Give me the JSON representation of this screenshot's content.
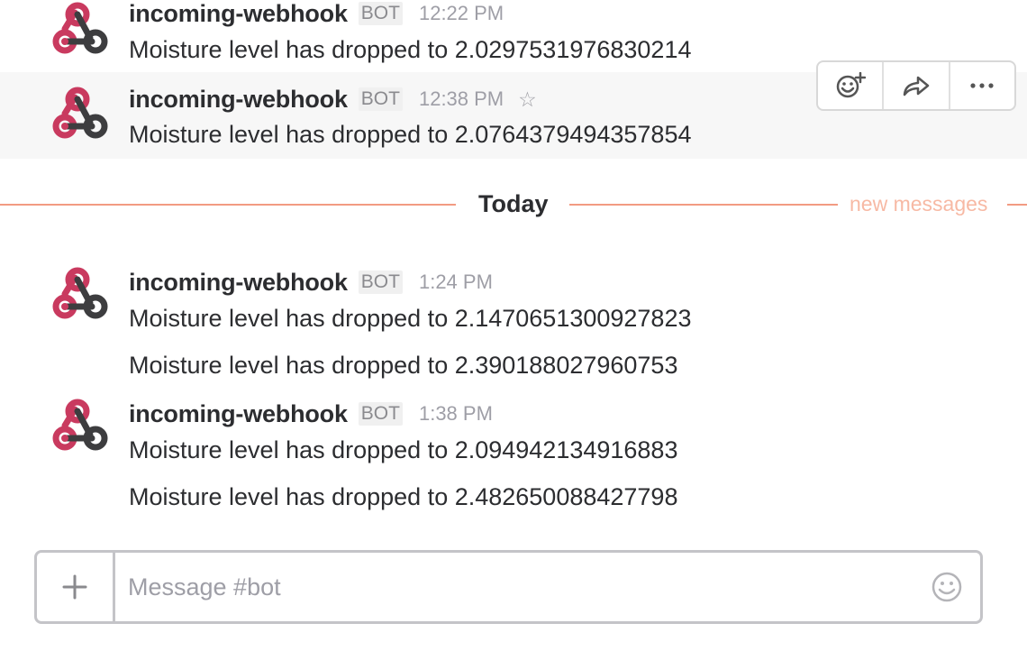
{
  "messages": [
    {
      "sender": "incoming-webhook",
      "badge": "BOT",
      "time": "12:22 PM",
      "lines": [
        "Moisture level has dropped to 2.0297531976830214"
      ]
    },
    {
      "sender": "incoming-webhook",
      "badge": "BOT",
      "time": "12:38 PM",
      "lines": [
        "Moisture level has dropped to 2.0764379494357854"
      ]
    },
    {
      "sender": "incoming-webhook",
      "badge": "BOT",
      "time": "1:24 PM",
      "lines": [
        "Moisture level has dropped to 2.1470651300927823",
        "Moisture level has dropped to 2.390188027960753"
      ]
    },
    {
      "sender": "incoming-webhook",
      "badge": "BOT",
      "time": "1:38 PM",
      "lines": [
        "Moisture level has dropped to 2.094942134916883",
        "Moisture level has dropped to 2.482650088427798"
      ]
    }
  ],
  "divider": {
    "label": "Today",
    "new_messages_label": "new messages"
  },
  "actions": {
    "icons": [
      "add-reaction-icon",
      "share-icon",
      "more-icon"
    ]
  },
  "composer": {
    "placeholder": "Message #bot",
    "plus_icon": "plus-icon",
    "emoji_icon": "emoji-icon"
  },
  "colors": {
    "divider_line": "#f29b82",
    "new_messages": "#f7b9a4",
    "webhook_pink": "#c93a5f",
    "webhook_dark": "#3d3d3f"
  }
}
